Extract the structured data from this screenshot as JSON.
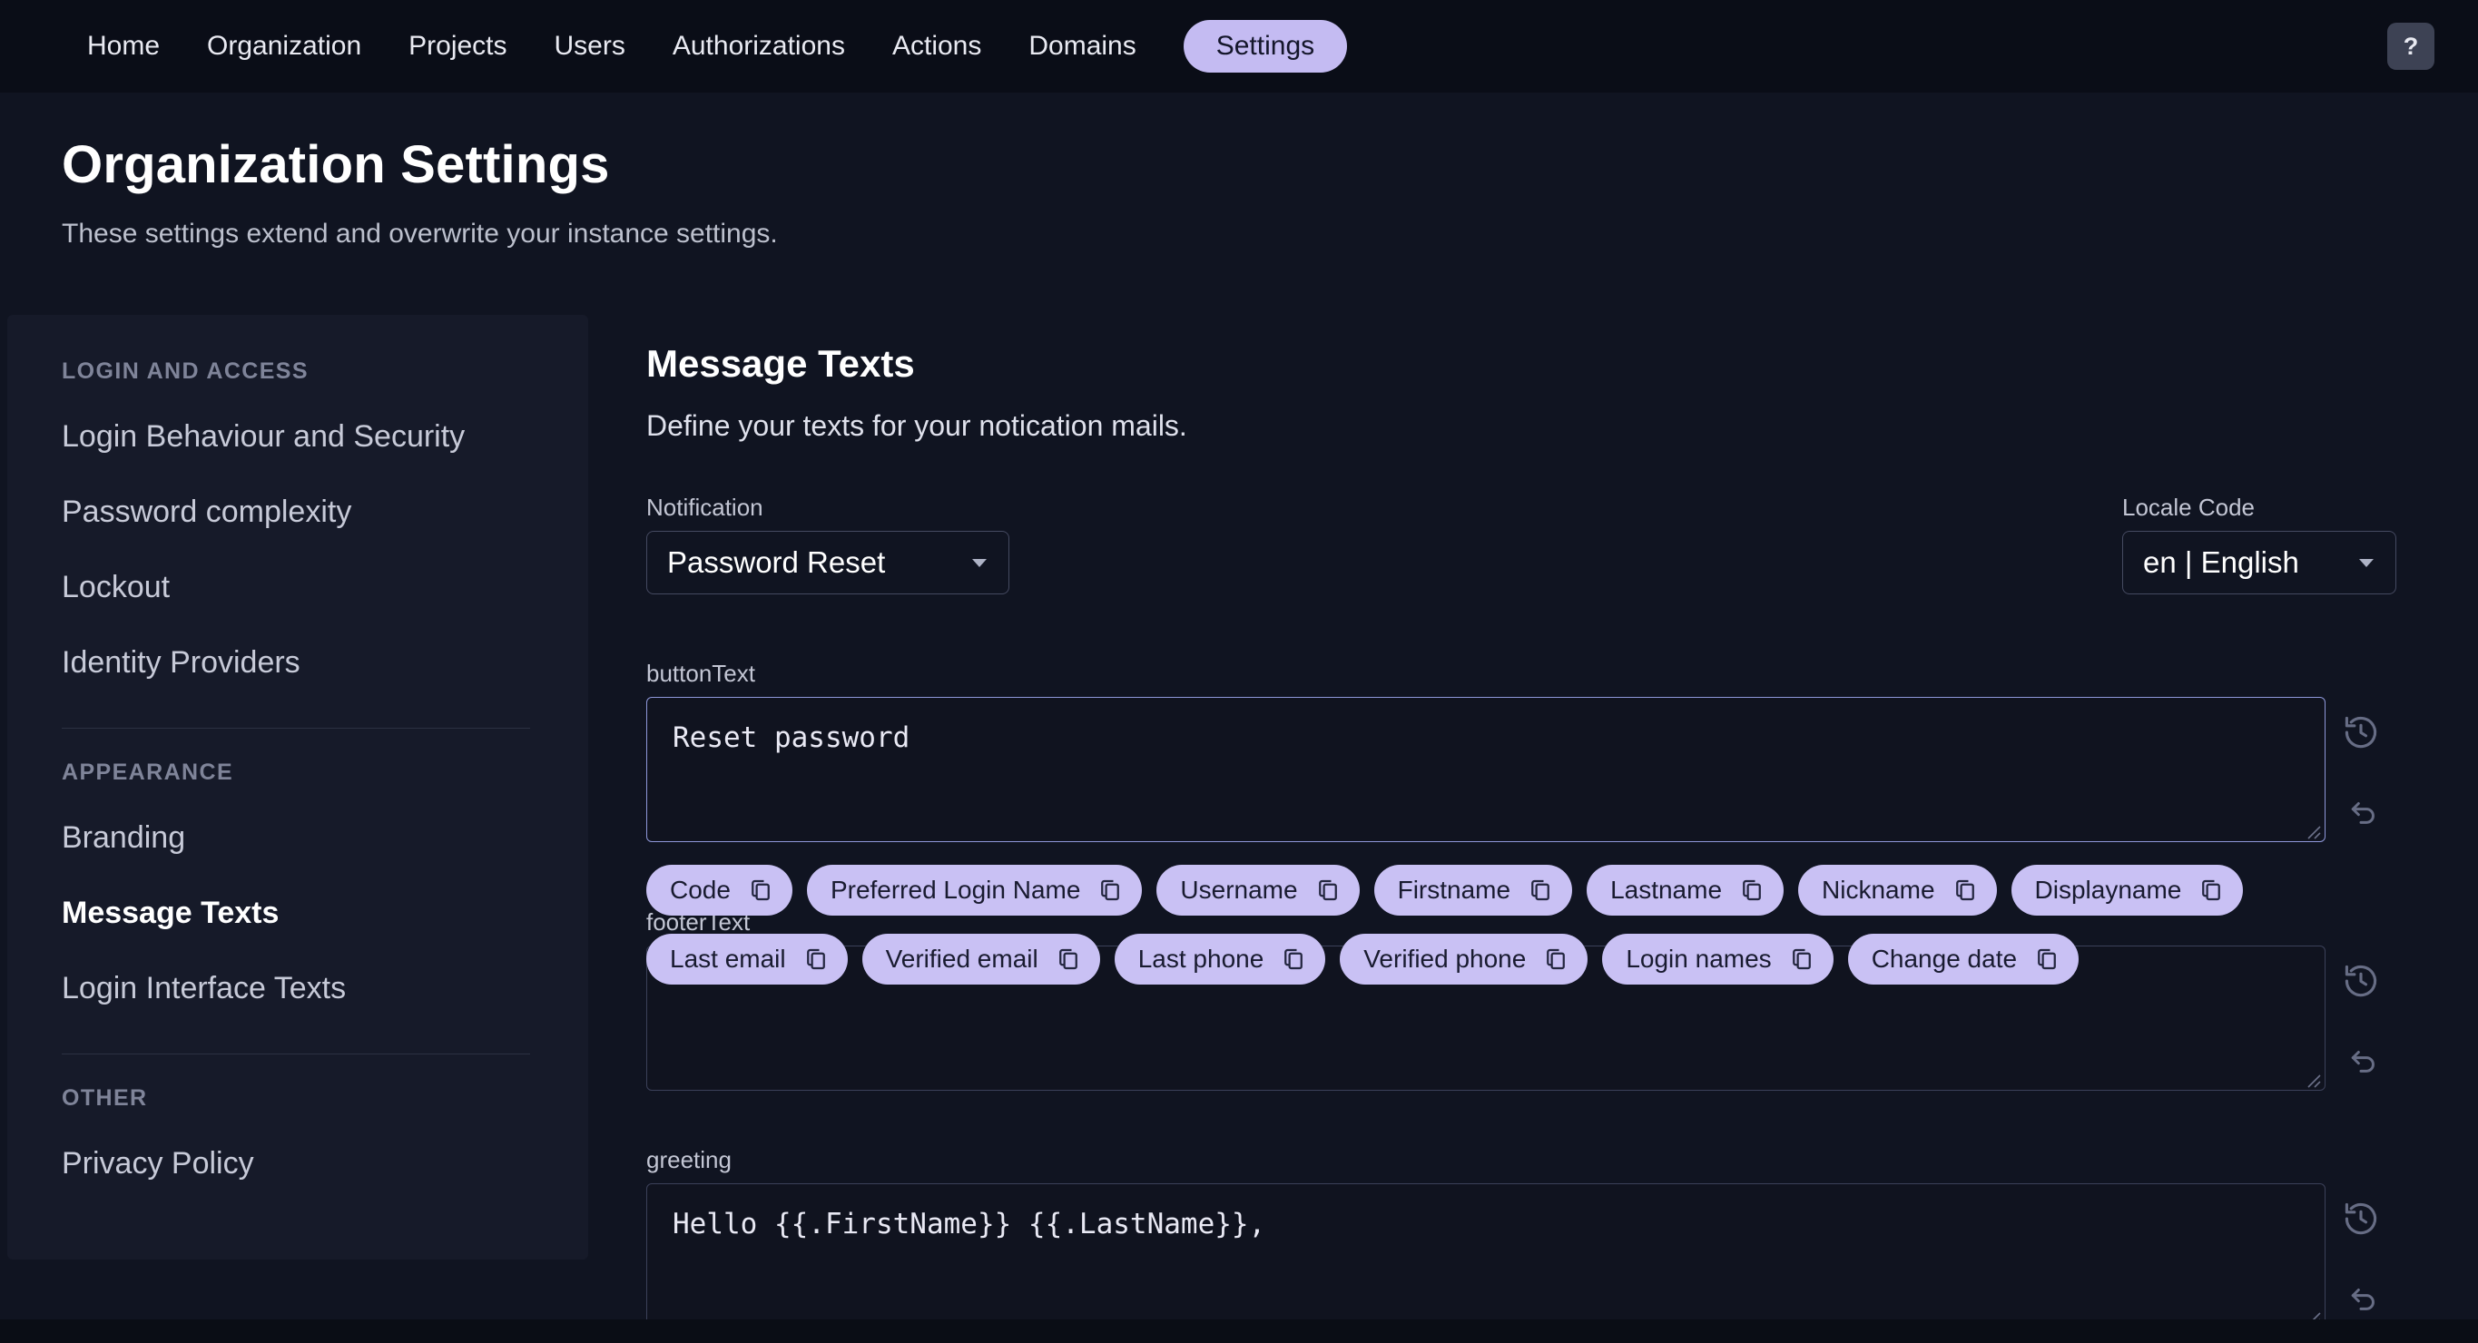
{
  "nav": {
    "items": [
      "Home",
      "Organization",
      "Projects",
      "Users",
      "Authorizations",
      "Actions",
      "Domains",
      "Settings"
    ],
    "active": "Settings",
    "help_label": "?"
  },
  "header": {
    "title": "Organization Settings",
    "subtitle": "These settings extend and overwrite your instance settings."
  },
  "sidebar": {
    "active_item": "Message Texts",
    "sections": [
      {
        "title": "LOGIN AND ACCESS",
        "items": [
          "Login Behaviour and Security",
          "Password complexity",
          "Lockout",
          "Identity Providers"
        ]
      },
      {
        "title": "APPEARANCE",
        "items": [
          "Branding",
          "Message Texts",
          "Login Interface Texts"
        ]
      },
      {
        "title": "OTHER",
        "items": [
          "Privacy Policy"
        ]
      }
    ]
  },
  "main": {
    "title": "Message Texts",
    "subtitle": "Define your texts for your notication mails.",
    "notification": {
      "label": "Notification",
      "value": "Password Reset"
    },
    "locale": {
      "label": "Locale Code",
      "value": "en | English"
    },
    "fields": [
      {
        "label": "buttonText",
        "value": "Reset password"
      },
      {
        "label": "footerText",
        "value": ""
      },
      {
        "label": "greeting",
        "value": "Hello {{.FirstName}} {{.LastName}},"
      }
    ],
    "chips": [
      "Code",
      "Preferred Login Name",
      "Username",
      "Firstname",
      "Lastname",
      "Nickname",
      "Displayname",
      "Last email",
      "Verified email",
      "Last phone",
      "Verified phone",
      "Login names",
      "Change date"
    ]
  },
  "icons": {
    "help": "help-icon",
    "chevron": "chevron-down-icon",
    "clipboard": "clipboard-icon",
    "history": "history-icon",
    "undo": "undo-icon",
    "resize": "resize-handle"
  },
  "colors": {
    "accent": "#c9c1f4",
    "accent_text": "#191b30",
    "focus_border": "#8f98da",
    "nav_bg": "#0a0d17",
    "page_bg": "#101421",
    "sidebar_bg": "#161a29",
    "input_border": "#3c415a",
    "muted_text": "#bcc0cd",
    "icon_gray": "#676d85"
  }
}
